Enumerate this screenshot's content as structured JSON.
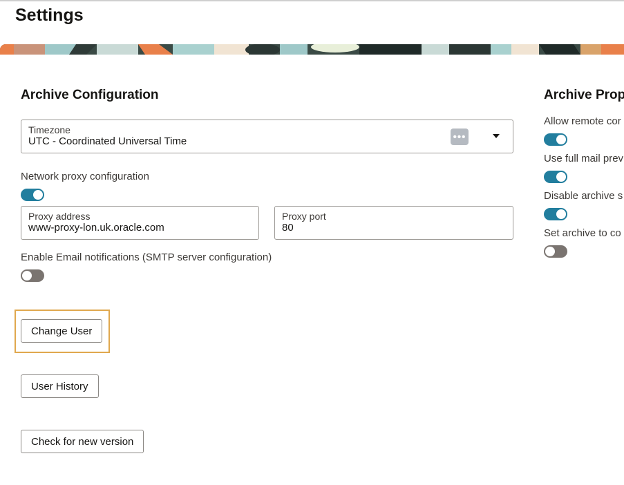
{
  "page": {
    "title": "Settings"
  },
  "archive_configuration": {
    "title": "Archive Configuration",
    "timezone": {
      "label": "Timezone",
      "value": "UTC - Coordinated Universal Time"
    },
    "network_proxy": {
      "label": "Network proxy configuration",
      "enabled": true
    },
    "proxy_address": {
      "label": "Proxy address",
      "value": "www-proxy-lon.uk.oracle.com"
    },
    "proxy_port": {
      "label": "Proxy port",
      "value": "80"
    },
    "email_notifications": {
      "label": "Enable Email notifications (SMTP server configuration)",
      "enabled": false
    },
    "buttons": {
      "change_user": "Change User",
      "user_history": "User History",
      "check_version": "Check for new version"
    }
  },
  "archive_properties": {
    "title": "Archive Prop",
    "items": [
      {
        "label": "Allow remote cor",
        "enabled": true
      },
      {
        "label": "Use full mail prev",
        "enabled": true
      },
      {
        "label": "Disable archive s",
        "enabled": true
      },
      {
        "label": "Set archive to co",
        "enabled": false
      }
    ]
  },
  "colors": {
    "accent": "#227e9e",
    "toggle_off": "#7a7470",
    "highlight": "#e0a84e"
  },
  "icons": {
    "timezone_badge": "ellipsis-icon",
    "dropdown": "caret-down-icon"
  }
}
